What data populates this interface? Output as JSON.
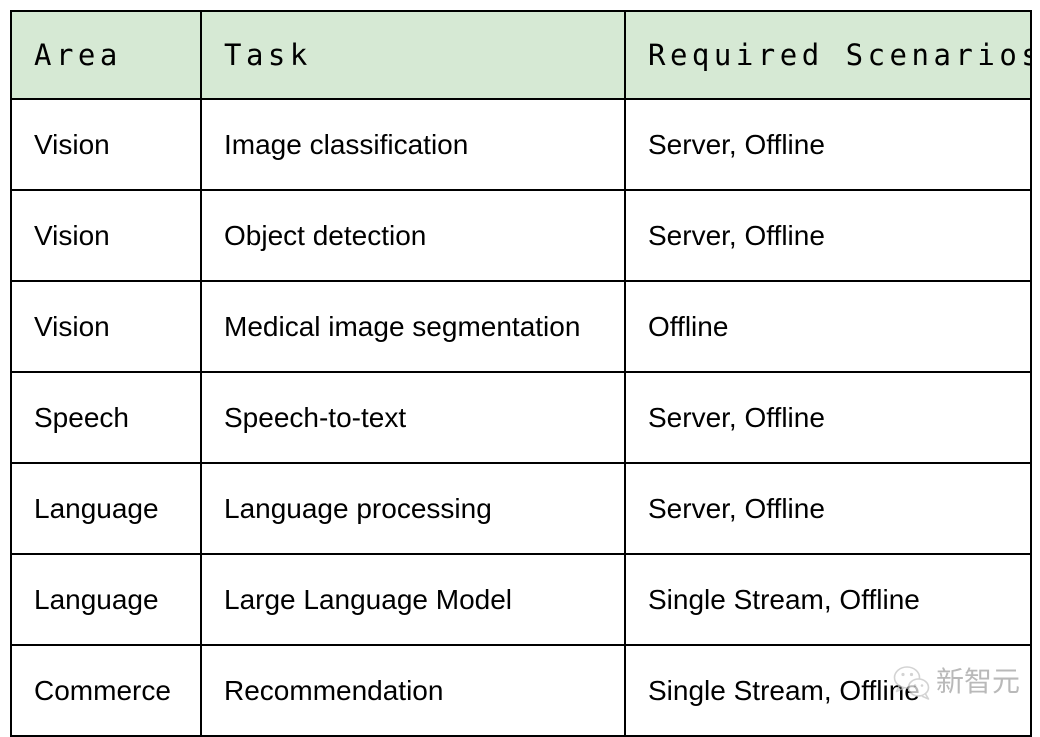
{
  "table": {
    "name": "MLPerf benchmark tasks table",
    "header_background": "#d6e9d4",
    "border_color": "#000000",
    "columns": [
      {
        "key": "area",
        "label": "Area"
      },
      {
        "key": "task",
        "label": "Task"
      },
      {
        "key": "scenarios",
        "label": "Required Scenarios"
      }
    ],
    "rows": [
      {
        "area": "Vision",
        "task": "Image classification",
        "scenarios": "Server, Offline"
      },
      {
        "area": "Vision",
        "task": "Object detection",
        "scenarios": "Server, Offline"
      },
      {
        "area": "Vision",
        "task": "Medical image segmentation",
        "scenarios": "Offline"
      },
      {
        "area": "Speech",
        "task": "Speech-to-text",
        "scenarios": "Server, Offline"
      },
      {
        "area": "Language",
        "task": "Language processing",
        "scenarios": "Server, Offline"
      },
      {
        "area": "Language",
        "task": "Large Language Model",
        "scenarios": "Single Stream, Offline"
      },
      {
        "area": "Commerce",
        "task": "Recommendation",
        "scenarios": "Single Stream, Offline"
      }
    ]
  },
  "watermark": {
    "icon": "wechat-bubbles-icon",
    "text": "新智元",
    "color": "#b9b9b9"
  }
}
